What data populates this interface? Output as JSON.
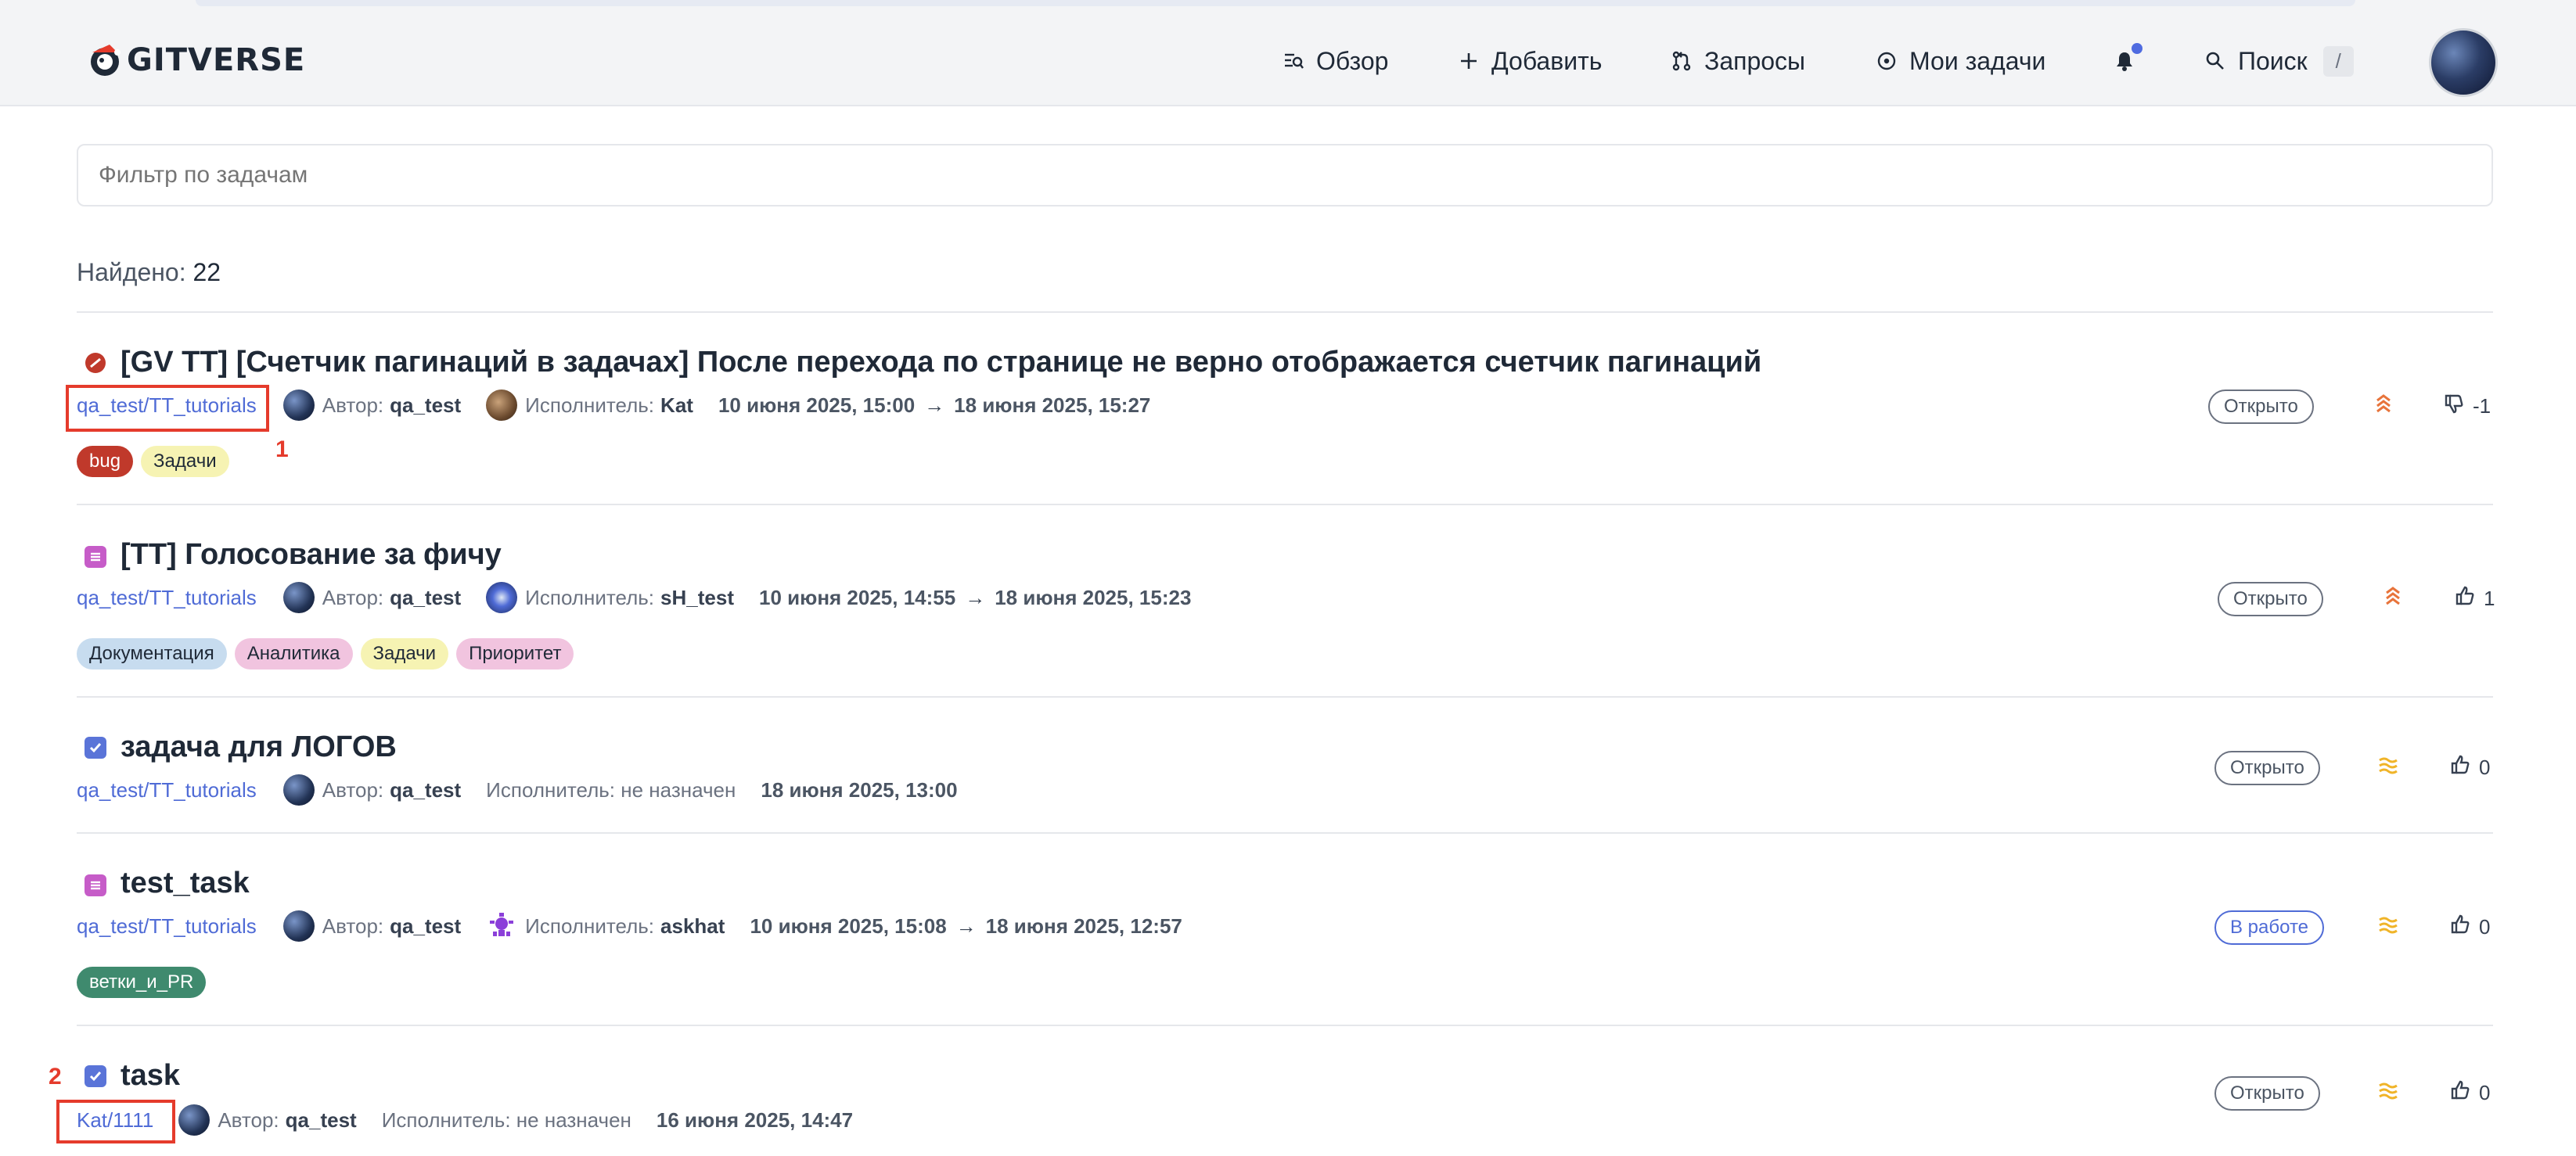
{
  "header": {
    "logo_text": "GITVERSE",
    "nav": {
      "overview": "Обзор",
      "add": "Добавить",
      "requests": "Запросы",
      "my_tasks": "Мои задачи",
      "search": "Поиск",
      "search_shortcut": "/"
    }
  },
  "filter": {
    "placeholder": "Фильтр по задачам"
  },
  "found": {
    "label": "Найдено:",
    "count": "22"
  },
  "meta_labels": {
    "author": "Автор:",
    "assignee": "Исполнитель:",
    "unassigned": "Исполнитель: не назначен"
  },
  "issues": [
    {
      "title": "[GV TT] [Счетчик пагинаций в задачах] После перехода по странице не верно отображается счетчик пагинаций",
      "type_icon": "bug-icon",
      "repo": "qa_test/TT_tutorials",
      "author": "qa_test",
      "assignee": "Kat",
      "date_from": "10 июня 2025, 15:00",
      "date_to": "18 июня 2025, 15:27",
      "labels": [
        {
          "text": "bug",
          "bg": "#c0392b",
          "color": "#ffffff"
        },
        {
          "text": "Задачи",
          "bg": "#f6f3b3",
          "color": "#1f2937"
        }
      ],
      "status": "Открыто",
      "priority_icon": "priority-high-icon",
      "votes": "-1",
      "vote_icon": "thumb-down-icon"
    },
    {
      "title": "[TT] Голосование за фичу",
      "type_icon": "list-icon",
      "repo": "qa_test/TT_tutorials",
      "author": "qa_test",
      "assignee": "sH_test",
      "date_from": "10 июня 2025, 14:55",
      "date_to": "18 июня 2025, 15:23",
      "labels": [
        {
          "text": "Документация",
          "bg": "#c7dcef",
          "color": "#1f2937"
        },
        {
          "text": "Аналитика",
          "bg": "#f1c4df",
          "color": "#1f2937"
        },
        {
          "text": "Задачи",
          "bg": "#f6f3b3",
          "color": "#1f2937"
        },
        {
          "text": "Приоритет",
          "bg": "#f1c4df",
          "color": "#1f2937"
        }
      ],
      "status": "Открыто",
      "priority_icon": "priority-high-icon",
      "votes": "1",
      "vote_icon": "thumb-up-icon"
    },
    {
      "title": "задача для ЛОГОВ",
      "type_icon": "checkbox-icon",
      "repo": "qa_test/TT_tutorials",
      "author": "qa_test",
      "date_to": "18 июня 2025, 13:00",
      "status": "Открыто",
      "priority_icon": "priority-medium-icon",
      "votes": "0",
      "vote_icon": "thumb-up-icon"
    },
    {
      "title": "test_task",
      "type_icon": "list-icon",
      "repo": "qa_test/TT_tutorials",
      "author": "qa_test",
      "assignee": "askhat",
      "date_from": "10 июня 2025, 15:08",
      "date_to": "18 июня 2025, 12:57",
      "labels": [
        {
          "text": "ветки_и_PR",
          "bg": "#3f8a6e",
          "color": "#ffffff"
        }
      ],
      "status": "В работе",
      "priority_icon": "priority-medium-icon",
      "votes": "0",
      "vote_icon": "thumb-up-icon"
    },
    {
      "title": "task",
      "type_icon": "checkbox-icon",
      "repo": "Kat/1111",
      "author": "qa_test",
      "date_to": "16 июня 2025, 14:47",
      "status": "Открыто",
      "priority_icon": "priority-medium-icon",
      "votes": "0",
      "vote_icon": "thumb-up-icon"
    }
  ],
  "annotations": {
    "first": "1",
    "second": "2"
  },
  "colors": {
    "accent": "#4f6bd6",
    "annotation": "#e53b2c",
    "priority_high": "#e8743b",
    "priority_medium": "#f0b429"
  }
}
